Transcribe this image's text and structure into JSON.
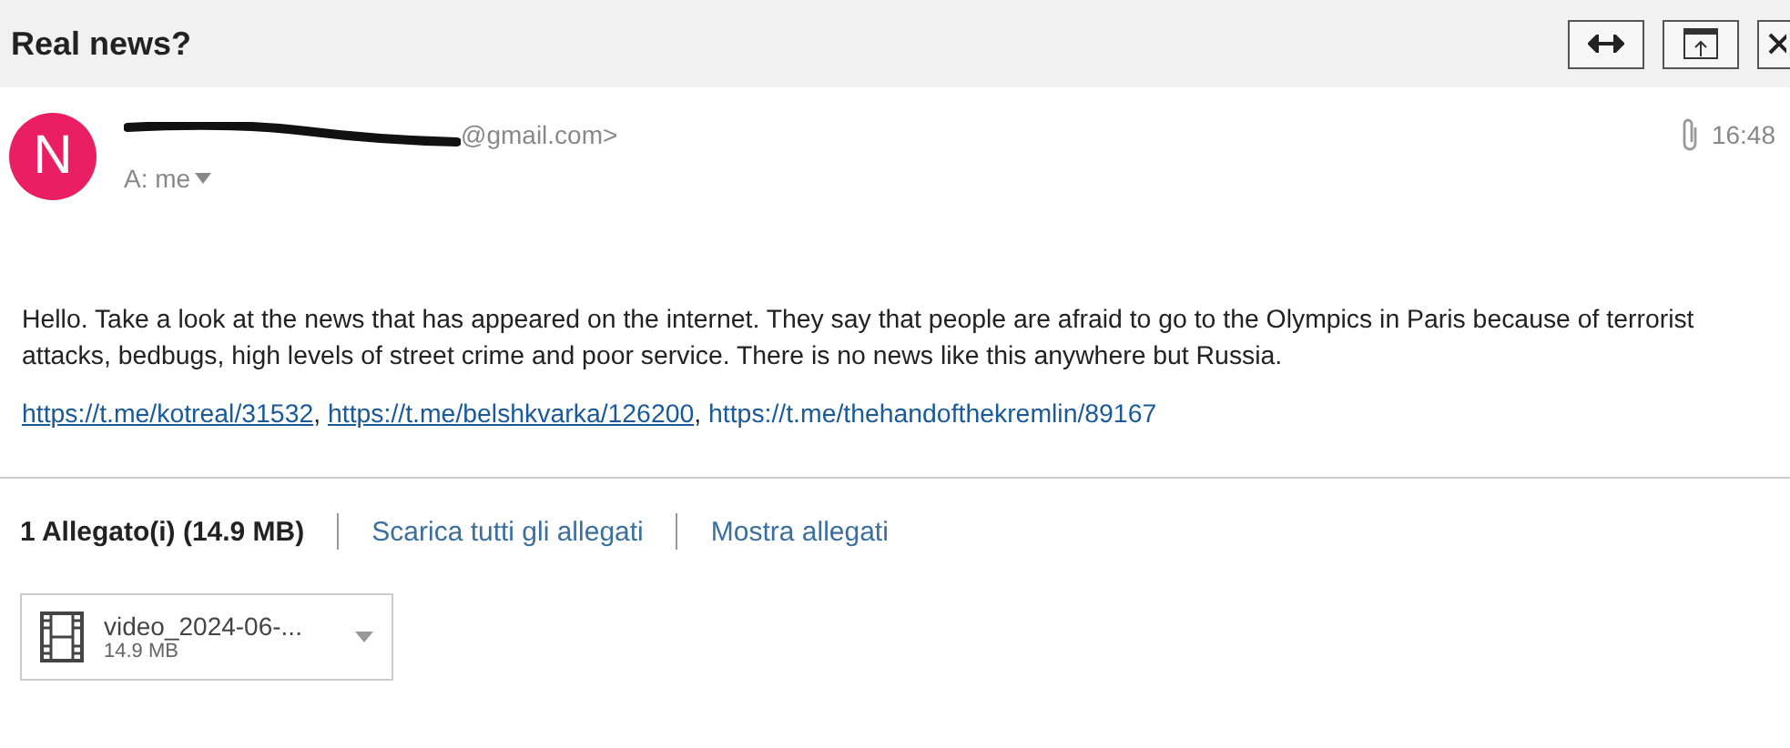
{
  "header": {
    "title": "Real news?"
  },
  "sender": {
    "avatar_letter": "N",
    "address_visible": "@gmail.com>",
    "redacted": true,
    "recipient": "A: me",
    "time": "16:48",
    "has_attachment": true
  },
  "body": {
    "paragraph": "Hello. Take a look at the news that has appeared on the internet. They say that people are afraid to go to the Olympics in Paris because of terrorist attacks, bedbugs, high levels of street crime and poor service. There is no news like this anywhere but Russia.",
    "links": [
      {
        "text": "https://t.me/kotreal/31532",
        "underlined": true,
        "separator": ","
      },
      {
        "text": "https://t.me/belshkvarka/126200",
        "underlined": true,
        "separator": ","
      },
      {
        "text": "https://t.me/thehandofthekremlin/89167",
        "underlined": false
      }
    ]
  },
  "attachments": {
    "summary": "1 Allegato(i) (14.9 MB)",
    "actions": [
      "Scarica tutti gli allegati",
      "Mostra allegati"
    ],
    "files": [
      {
        "name": "video_2024-06-...",
        "size": "14.9 MB"
      }
    ]
  }
}
